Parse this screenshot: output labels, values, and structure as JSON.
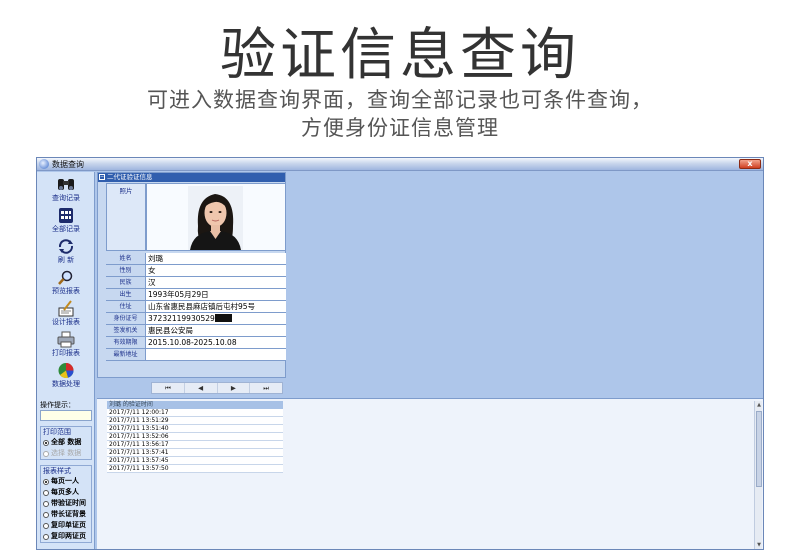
{
  "hero": {
    "title": "验证信息查询",
    "subtitle_line1": "可进入数据查询界面，查询全部记录也可条件查询，",
    "subtitle_line2": "方便身份证信息管理"
  },
  "window": {
    "title": "数据查询",
    "close_label": "x"
  },
  "toolbar": [
    {
      "label": "查询记录",
      "icon": "binoculars-icon"
    },
    {
      "label": "全部记录",
      "icon": "grid-icon"
    },
    {
      "label": "刷 新",
      "icon": "refresh-icon"
    },
    {
      "label": "预览报表",
      "icon": "magnifier-icon"
    },
    {
      "label": "设计报表",
      "icon": "design-icon"
    },
    {
      "label": "打印报表",
      "icon": "printer-icon"
    },
    {
      "label": "数据处理",
      "icon": "pie-chart-icon"
    }
  ],
  "operation_hint": {
    "label": "操作提示：",
    "value": ""
  },
  "print_range": {
    "title": "打印范围",
    "options": [
      {
        "label": "全部 数据",
        "selected": true,
        "enabled": true
      },
      {
        "label": "选择 数据",
        "selected": false,
        "enabled": false
      }
    ]
  },
  "report_style": {
    "title": "报表样式",
    "options": [
      {
        "label": "每页一人",
        "selected": true
      },
      {
        "label": "每页多人",
        "selected": false
      },
      {
        "label": "带验证时间",
        "selected": false
      },
      {
        "label": "带长证背景",
        "selected": false
      },
      {
        "label": "复印单证页",
        "selected": false
      },
      {
        "label": "复印两证页",
        "selected": false
      }
    ]
  },
  "id_card": {
    "header": "二代证验证信息",
    "collapse_glyph": "−",
    "photo_label": "照片",
    "fields": [
      {
        "key": "姓名",
        "value": "刘璐"
      },
      {
        "key": "性别",
        "value": "女"
      },
      {
        "key": "民族",
        "value": "汉"
      },
      {
        "key": "出生",
        "value": "1993年05月29日"
      },
      {
        "key": "住址",
        "value": "山东省惠民县麻店镇后屯村95号"
      },
      {
        "key": "身份证号",
        "value": "37232119930529"
      },
      {
        "key": "签发机关",
        "value": "惠民县公安局"
      },
      {
        "key": "有效期限",
        "value": "2015.10.08-2025.10.08"
      },
      {
        "key": "最新地址",
        "value": ""
      }
    ]
  },
  "navigator": [
    "⏮",
    "◀",
    "▶",
    "⏭"
  ],
  "log": {
    "header": "刘璐 的验证时间",
    "rows": [
      "2017/7/11 12:00:17",
      "2017/7/11 13:51:29",
      "2017/7/11 13:51:40",
      "2017/7/11 13:52:06",
      "2017/7/11 13:56:17",
      "2017/7/11 13:57:41",
      "2017/7/11 13:57:45",
      "2017/7/11 13:57:50"
    ]
  },
  "scroll": {
    "up": "▲",
    "down": "▼"
  }
}
